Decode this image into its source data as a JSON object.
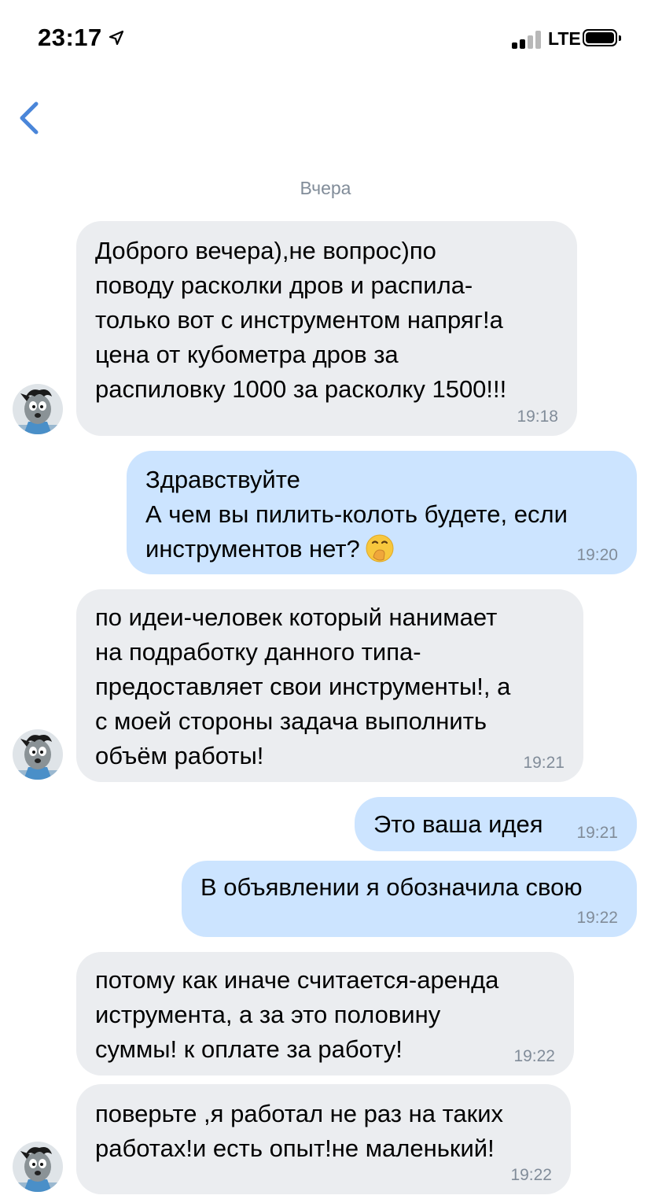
{
  "status_bar": {
    "time": "23:17",
    "network": "LTE"
  },
  "header": {
    "back_icon": "chevron-left-icon"
  },
  "chat": {
    "date_separator": "Вчера",
    "messages": [
      {
        "direction": "incoming",
        "text": "Доброго вечера),не вопрос)по\nповоду расколки дров и распила-\nтолько вот с инструментом напряг!а\nцена от кубометра дров за\nраспиловку 1000 за расколку 1500!!!",
        "time": "19:18"
      },
      {
        "direction": "outgoing",
        "text": "Здравствуйте\nА чем вы пилить-колоть будете, если\nинструментов нет?",
        "emoji": "face-with-hand-over-mouth",
        "time": "19:20"
      },
      {
        "direction": "incoming",
        "text": "по идеи-человек который нанимает\nна подработку данного типа-\nпредоставляет свои инструменты!, а\nс моей стороны задача выполнить\nобъём работы!",
        "time": "19:21"
      },
      {
        "direction": "outgoing",
        "text": "Это ваша идея",
        "time": "19:21"
      },
      {
        "direction": "outgoing",
        "text": "В объявлении я обозначила свою",
        "time": "19:22"
      },
      {
        "direction": "incoming",
        "text": "потому как иначе считается-аренда\nиструмента, а за это половину\nсуммы! к оплате за работу!",
        "time": "19:22"
      },
      {
        "direction": "incoming",
        "text": "поверьте ,я работал не раз на таких\nработах!и есть опыт!не маленький!",
        "time": "19:22"
      }
    ]
  },
  "colors": {
    "incoming_bubble": "#ebedf0",
    "outgoing_bubble": "#cce4ff",
    "accent": "#4a86d9",
    "timestamp": "#818c99"
  }
}
